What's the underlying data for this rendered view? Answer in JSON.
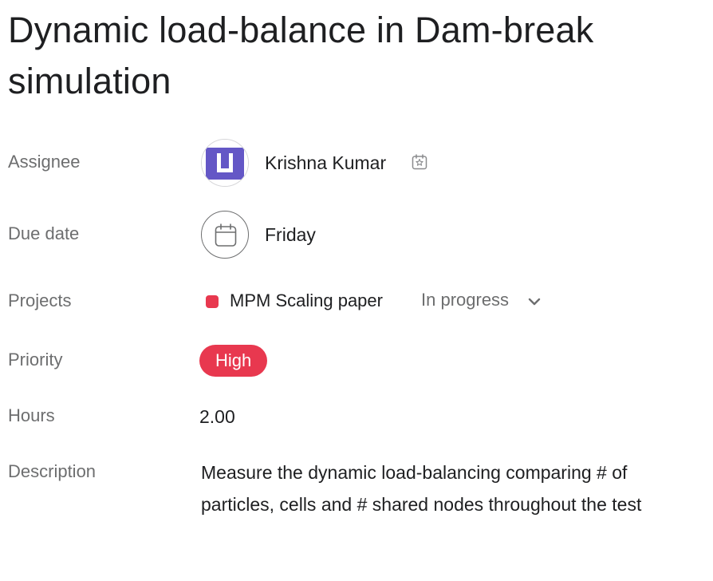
{
  "task": {
    "title": "Dynamic load-balance in Dam-break simulation"
  },
  "fields": {
    "assignee": {
      "label": "Assignee",
      "name": "Krishna Kumar",
      "avatar_color": "#6457c6",
      "badge_icon": "calendar-star-icon"
    },
    "due_date": {
      "label": "Due date",
      "value": "Friday",
      "icon": "calendar-icon"
    },
    "projects": {
      "label": "Projects",
      "name": "MPM Scaling paper",
      "color": "#e8384f",
      "status": "In progress",
      "status_icon": "chevron-down-icon"
    },
    "priority": {
      "label": "Priority",
      "value": "High",
      "color": "#e8384f"
    },
    "hours": {
      "label": "Hours",
      "value": "2.00"
    },
    "description": {
      "label": "Description",
      "text": "Measure the dynamic load-balancing comparing # of particles, cells and # shared nodes throughout the test"
    }
  }
}
